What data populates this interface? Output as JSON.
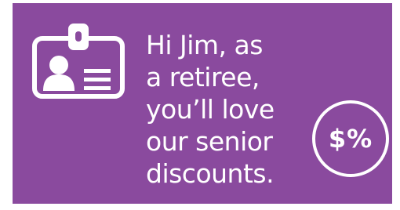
{
  "banner": {
    "background_color": "#8a4a9e",
    "icon": "id-badge-icon",
    "message_lines": [
      "Hi Jim, as",
      "a retiree,",
      "you’ll love",
      "our senior",
      "discounts."
    ],
    "badge_icon": "discount-badge-icon",
    "badge_text": "$%"
  }
}
